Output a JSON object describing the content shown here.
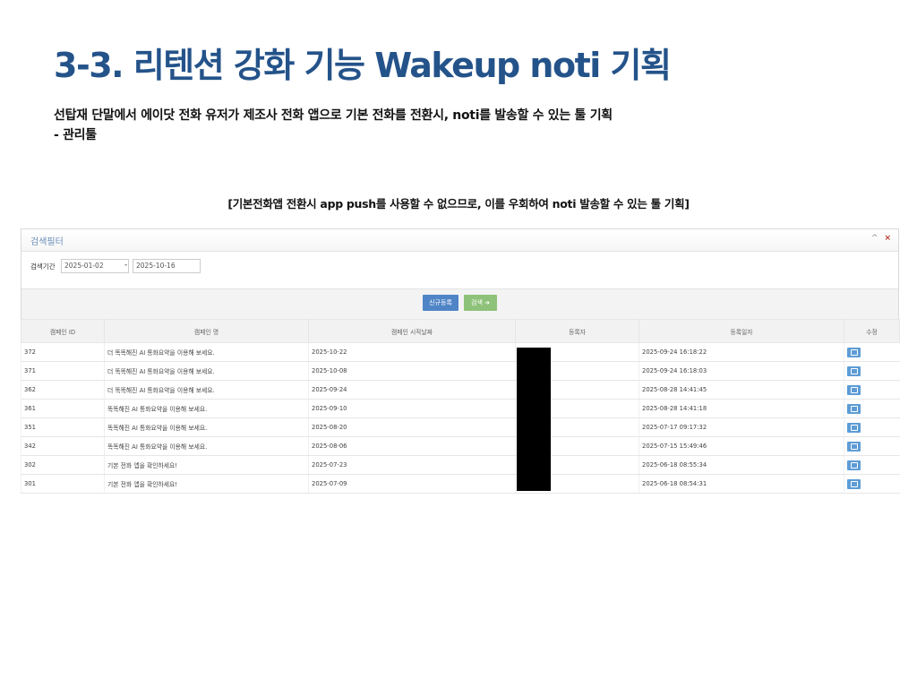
{
  "slide": {
    "title": "3-3. 리텐션 강화 기능 Wakeup noti 기획",
    "desc_line1": "선탑재 단말에서 에이닷 전화 유저가 제조사 전화 앱으로 기본 전화를 전환시, noti를 발송할 수 있는 툴 기획",
    "desc_line2": "- 관리툴",
    "caption": "[기본전화앱 전환시 app push를 사용할 수 없으므로, 이를 우회하여 noti 발송할 수 있는 툴 기획]"
  },
  "panel": {
    "title": "검색필터",
    "tools": {
      "collapse": "^",
      "close": "×"
    },
    "filter_label": "검색기간",
    "date_from": "2025-01-02",
    "date_separator": "-",
    "date_to": "2025-10-16",
    "new_button": "신규등록",
    "search_button": "검색 ➜"
  },
  "table": {
    "headers": [
      "캠페인 ID",
      "캠페인 명",
      "캠페인 시작날짜",
      "등록자",
      "등록일자",
      "수정"
    ],
    "rows": [
      {
        "id": "372",
        "name": "더 똑똑해진 AI 통화요약을 이용해 보세요.",
        "start": "2025-10-22",
        "reg": "2025-09-24 16:18:22"
      },
      {
        "id": "371",
        "name": "더 똑똑해진 AI 통화요약을 이용해 보세요.",
        "start": "2025-10-08",
        "reg": "2025-09-24 16:18:03"
      },
      {
        "id": "362",
        "name": "더 똑똑해진 AI 통화요약을 이용해 보세요.",
        "start": "2025-09-24",
        "reg": "2025-08-28 14:41:45"
      },
      {
        "id": "361",
        "name": "똑똑해진 AI 통화요약을 이용해 보세요.",
        "start": "2025-09-10",
        "reg": "2025-08-28 14:41:18"
      },
      {
        "id": "351",
        "name": "똑똑해진 AI 통화요약을 이용해 보세요.",
        "start": "2025-08-20",
        "reg": "2025-07-17 09:17:32"
      },
      {
        "id": "342",
        "name": "똑똑해진 AI 통화요약을 이용해 보세요.",
        "start": "2025-08-06",
        "reg": "2025-07-15 15:49:46"
      },
      {
        "id": "302",
        "name": "기본 전화 앱을 확인하세요!",
        "start": "2025-07-23",
        "reg": "2025-06-18 08:55:34"
      },
      {
        "id": "301",
        "name": "기본 전화 앱을 확인하세요!",
        "start": "2025-07-09",
        "reg": "2025-06-18 08:54:31"
      }
    ]
  },
  "icons": {
    "edit": "edit-icon",
    "collapse": "chevron-up-icon",
    "close": "close-icon"
  },
  "colors": {
    "title": "#24538a",
    "new_button": "#4f85c7",
    "search_button": "#8ec27a",
    "edit_button": "#5d9cd6"
  }
}
